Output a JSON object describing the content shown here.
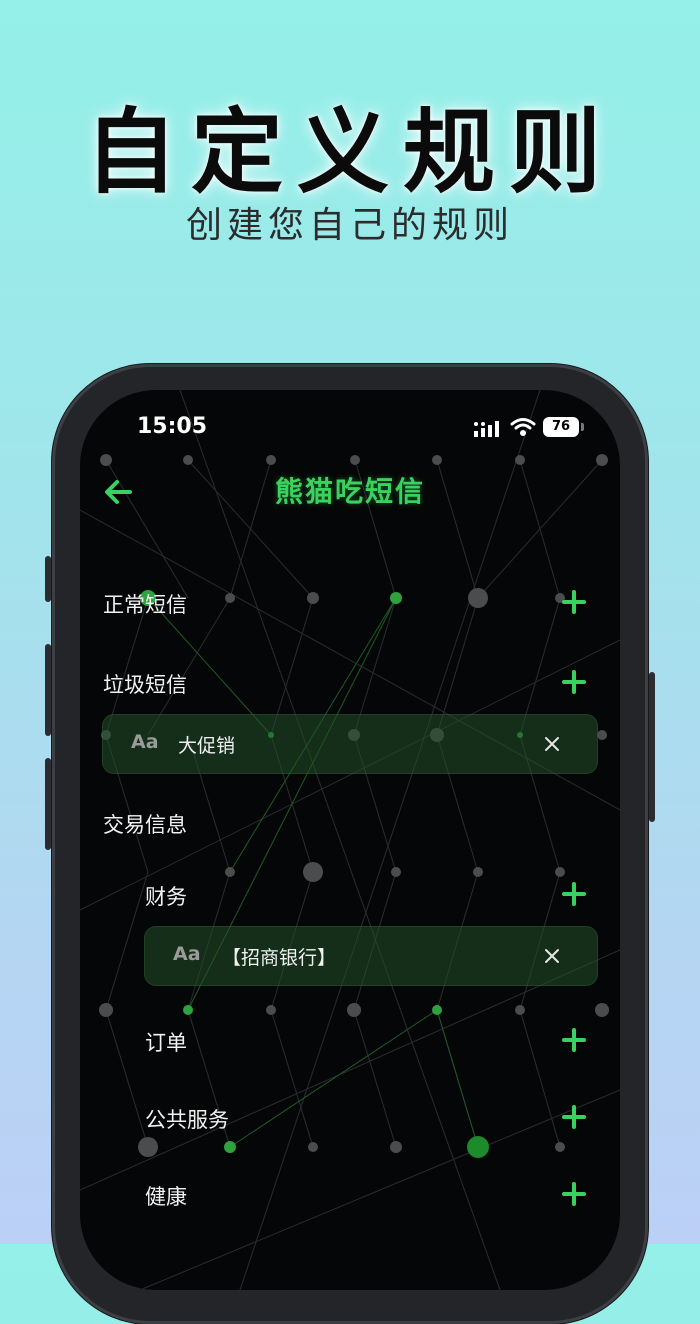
{
  "headline": "自定义规则",
  "subheadline": "创建您自己的规则",
  "status_bar": {
    "time": "15:05",
    "battery": "76"
  },
  "app": {
    "title": "熊猫吃短信",
    "colors": {
      "accent": "#3ad15e",
      "card": "#16351c",
      "screen_bg": "#050607"
    },
    "categories": [
      {
        "label": "正常短信"
      },
      {
        "label": "垃圾短信",
        "keyword": {
          "prefix": "Aa",
          "text": "大促销"
        }
      },
      {
        "label": "交易信息"
      }
    ],
    "subcategories": [
      {
        "label": "财务",
        "keyword": {
          "prefix": "Aa",
          "text": "【招商银行】"
        }
      },
      {
        "label": "订单"
      },
      {
        "label": "公共服务"
      },
      {
        "label": "健康"
      }
    ],
    "icons": [
      "back-arrow-icon",
      "plus-icon",
      "close-icon",
      "signal-icon",
      "wifi-icon",
      "battery-icon"
    ]
  }
}
